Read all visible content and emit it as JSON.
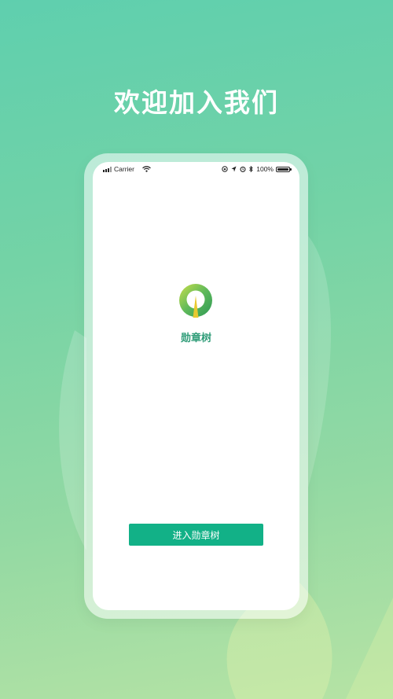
{
  "headline": "欢迎加入我们",
  "status_bar": {
    "carrier": "Carrier",
    "battery": "100%",
    "icons": [
      "signal-icon",
      "wifi-icon",
      "lock-rotation-icon",
      "location-icon",
      "alarm-icon",
      "bluetooth-icon",
      "battery-icon"
    ]
  },
  "app": {
    "name": "勋章树",
    "logo": "medal-tree-logo"
  },
  "button": {
    "label": "进入勋章树"
  },
  "colors": {
    "accent": "#12b187",
    "app_name": "#2f9c78",
    "background_top": "#5fcfae",
    "background_bottom": "#b6e3a4",
    "logo_gold": "#e8c930",
    "logo_green": "#3aa85a"
  }
}
